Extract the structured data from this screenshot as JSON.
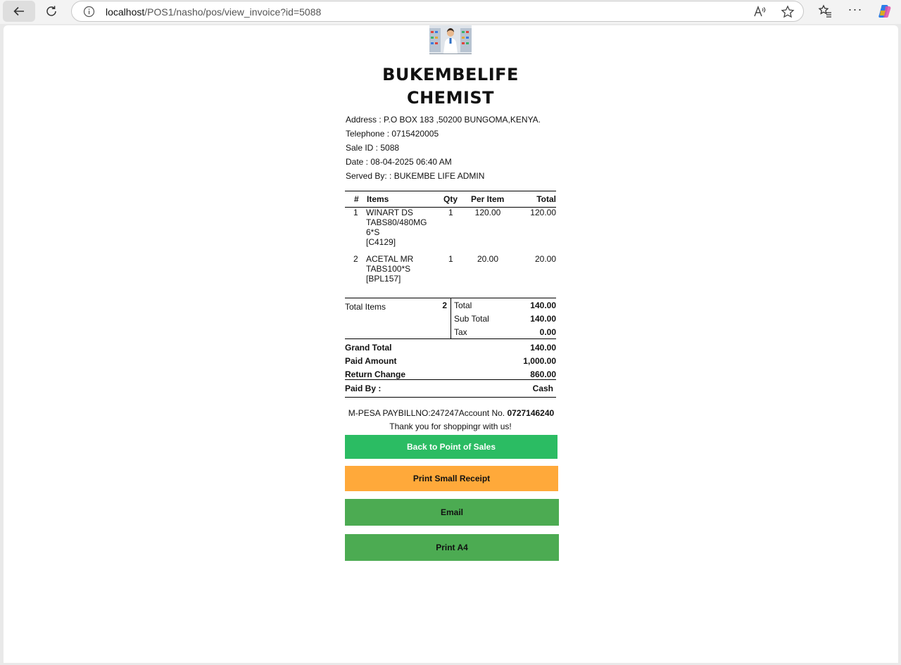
{
  "browser": {
    "url_host": "localhost",
    "url_path": "/POS1/nasho/pos/view_invoice?id=5088",
    "icons": [
      "back-arrow-icon",
      "reload-icon",
      "info-icon",
      "read-aloud-icon",
      "star-icon",
      "favorites-icon",
      "more-icon",
      "copilot-icon"
    ]
  },
  "store": {
    "name_line1": "BUKEMBELIFE",
    "name_line2": "CHEMIST",
    "address": "Address : P.O BOX 183 ,50200 BUNGOMA,KENYA.",
    "telephone": "Telephone : 0715420005",
    "sale_id": "Sale ID : 5088",
    "date": "Date : 08-04-2025 06:40 AM",
    "served_by": "Served By:  : BUKEMBE LIFE ADMIN"
  },
  "table": {
    "headers": {
      "num": "#",
      "items": "Items",
      "qty": "Qty",
      "per_item": "Per Item",
      "total": "Total"
    },
    "rows": [
      {
        "num": "1",
        "item_lines": [
          "WINART DS",
          "TABS80/480MG",
          "6*S",
          "[C4129]"
        ],
        "qty": "1",
        "per_item": "120.00",
        "total": "120.00"
      },
      {
        "num": "2",
        "item_lines": [
          "ACETAL MR",
          "TABS100*S",
          "[BPL157]"
        ],
        "qty": "1",
        "per_item": "20.00",
        "total": "20.00"
      }
    ]
  },
  "summary": {
    "total_items_label": "Total Items",
    "total_items_value": "2",
    "total_label": "Total",
    "total_value": "140.00",
    "subtotal_label": "Sub Total",
    "subtotal_value": "140.00",
    "tax_label": "Tax",
    "tax_value": "0.00",
    "grand_total_label": "Grand Total",
    "grand_total_value": "140.00",
    "paid_amount_label": "Paid Amount",
    "paid_amount_value": "1,000.00",
    "return_change_label": "Return Change",
    "return_change_value": "860.00",
    "paid_by_label": "Paid By :",
    "paid_by_value": "Cash"
  },
  "footer": {
    "mpesa_text": "M-PESA PAYBILLNO:247247Account No. ",
    "mpesa_account": "0727146240",
    "thanks": "Thank you for shoppingr with us!"
  },
  "buttons": {
    "back_to_pos": "Back to Point of Sales",
    "print_small": "Print Small Receipt",
    "email": "Email",
    "print_a4": "Print A4"
  },
  "colors": {
    "back_to_pos": "#2bbc63",
    "print_small": "#ffa93a",
    "email": "#4cab52",
    "print_a4": "#4cab52"
  }
}
